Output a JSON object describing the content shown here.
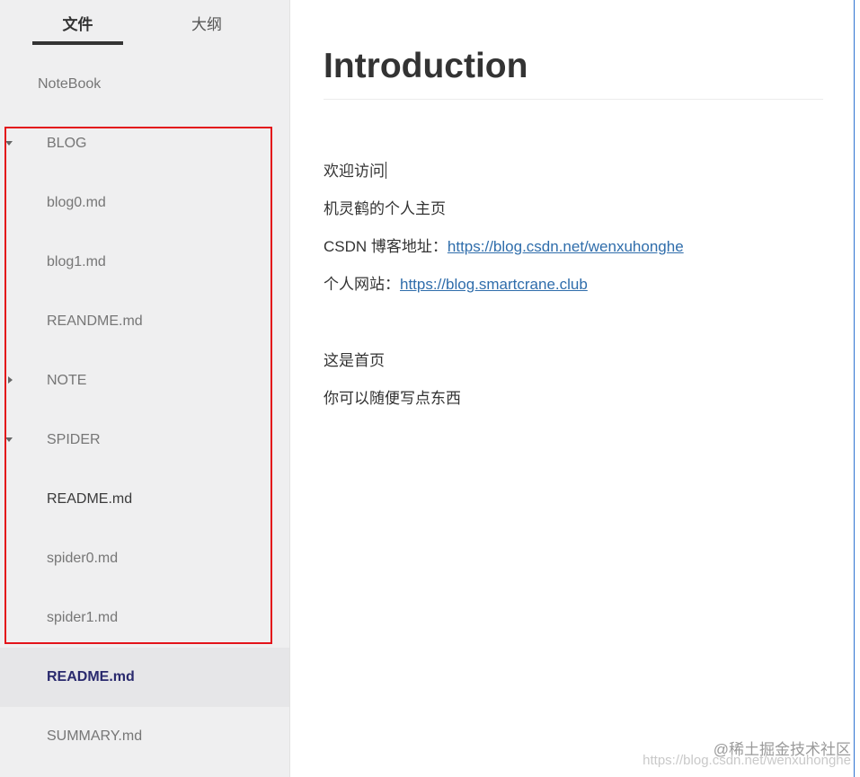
{
  "sidebar": {
    "tabs": [
      {
        "label": "文件",
        "active": true
      },
      {
        "label": "大纲",
        "active": false
      }
    ],
    "items": [
      {
        "label": "NoteBook"
      },
      {
        "label": "BLOG",
        "caret": "down"
      },
      {
        "label": "blog0.md"
      },
      {
        "label": "blog1.md"
      },
      {
        "label": "REANDME.md"
      },
      {
        "label": "NOTE",
        "caret": "right"
      },
      {
        "label": "SPIDER",
        "caret": "down"
      },
      {
        "label": "README.md"
      },
      {
        "label": "spider0.md"
      },
      {
        "label": "spider1.md"
      },
      {
        "label": "README.md",
        "selected": true
      },
      {
        "label": "SUMMARY.md"
      }
    ]
  },
  "document": {
    "title": "Introduction",
    "lines": [
      "欢迎访问",
      "机灵鹤的个人主页",
      "CSDN 博客地址：",
      "个人网站：",
      "这是首页",
      "你可以随便写点东西"
    ],
    "links": {
      "csdn": "https://blog.csdn.net/wenxuhonghe",
      "site": "https://blog.smartcrane.club"
    }
  },
  "watermark": {
    "line1": "@稀土掘金技术社区",
    "line2": "https://blog.csdn.net/wenxuhonghe"
  },
  "colors": {
    "sidebar_bg": "#efeff0",
    "highlight_box": "#e3131a",
    "link": "#2f6dab",
    "selected_text": "#2a2a6e"
  }
}
